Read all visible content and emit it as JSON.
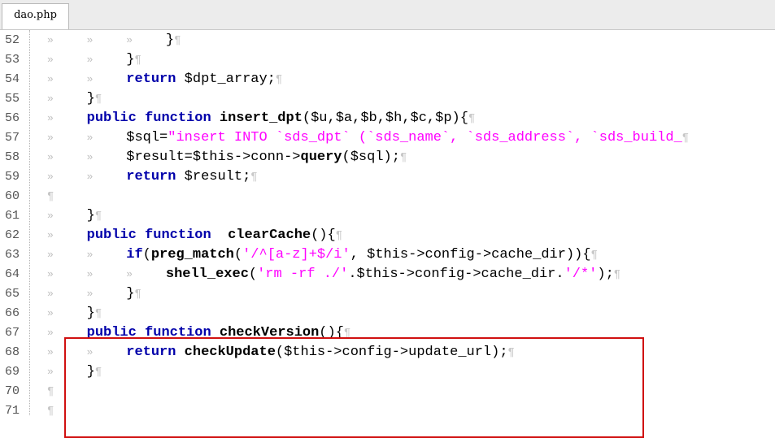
{
  "tab": {
    "filename": "dao.php"
  },
  "colors": {
    "keyword": "#0000aa",
    "string": "#ff00ff",
    "highlight": "#d01010"
  },
  "lines": [
    {
      "n": "52",
      "indent": 3,
      "segs": [
        {
          "t": "}",
          "c": "br"
        }
      ]
    },
    {
      "n": "53",
      "indent": 2,
      "segs": [
        {
          "t": "}",
          "c": "br"
        }
      ]
    },
    {
      "n": "54",
      "indent": 2,
      "segs": [
        {
          "t": "return",
          "c": "kw"
        },
        {
          "t": " $dpt_array;",
          "c": "br"
        }
      ]
    },
    {
      "n": "55",
      "indent": 1,
      "segs": [
        {
          "t": "}",
          "c": "br"
        }
      ]
    },
    {
      "n": "56",
      "indent": 1,
      "segs": [
        {
          "t": "public",
          "c": "kw"
        },
        {
          "t": " ",
          "c": "br"
        },
        {
          "t": "function",
          "c": "kw"
        },
        {
          "t": " ",
          "c": "br"
        },
        {
          "t": "insert_dpt",
          "c": "fn"
        },
        {
          "t": "($u,$a,$b,$h,$c,$p){",
          "c": "br"
        }
      ]
    },
    {
      "n": "57",
      "indent": 2,
      "segs": [
        {
          "t": "$sql=",
          "c": "br"
        },
        {
          "t": "\"insert INTO `sds_dpt` (`sds_name`, `sds_address`, `sds_build_",
          "c": "str"
        }
      ]
    },
    {
      "n": "58",
      "indent": 2,
      "segs": [
        {
          "t": "$result=$this->conn->",
          "c": "br"
        },
        {
          "t": "query",
          "c": "fn"
        },
        {
          "t": "($sql);",
          "c": "br"
        }
      ]
    },
    {
      "n": "59",
      "indent": 2,
      "segs": [
        {
          "t": "return",
          "c": "kw"
        },
        {
          "t": " $result;",
          "c": "br"
        }
      ]
    },
    {
      "n": "60",
      "indent": 0,
      "segs": []
    },
    {
      "n": "61",
      "indent": 1,
      "segs": [
        {
          "t": "}",
          "c": "br"
        }
      ]
    },
    {
      "n": "62",
      "indent": 1,
      "segs": [
        {
          "t": "public",
          "c": "kw"
        },
        {
          "t": " ",
          "c": "br"
        },
        {
          "t": "function",
          "c": "kw"
        },
        {
          "t": "  ",
          "c": "br"
        },
        {
          "t": "clearCache",
          "c": "fn"
        },
        {
          "t": "(){",
          "c": "br"
        }
      ]
    },
    {
      "n": "63",
      "indent": 2,
      "segs": [
        {
          "t": "if",
          "c": "kw"
        },
        {
          "t": "(",
          "c": "br"
        },
        {
          "t": "preg_match",
          "c": "fn"
        },
        {
          "t": "(",
          "c": "br"
        },
        {
          "t": "'/^[a-z]+$/i'",
          "c": "str"
        },
        {
          "t": ", $this->config->cache_dir)){",
          "c": "br"
        }
      ]
    },
    {
      "n": "64",
      "indent": 3,
      "segs": [
        {
          "t": "shell_exec",
          "c": "fn"
        },
        {
          "t": "(",
          "c": "br"
        },
        {
          "t": "'rm -rf ./'",
          "c": "str"
        },
        {
          "t": ".$this->config->cache_dir.",
          "c": "br"
        },
        {
          "t": "'/*'",
          "c": "str"
        },
        {
          "t": ");",
          "c": "br"
        }
      ]
    },
    {
      "n": "65",
      "indent": 2,
      "segs": [
        {
          "t": "}",
          "c": "br"
        }
      ]
    },
    {
      "n": "66",
      "indent": 1,
      "segs": [
        {
          "t": "}",
          "c": "br"
        }
      ]
    },
    {
      "n": "67",
      "indent": 1,
      "segs": [
        {
          "t": "public",
          "c": "kw"
        },
        {
          "t": " ",
          "c": "br"
        },
        {
          "t": "function",
          "c": "kw"
        },
        {
          "t": " ",
          "c": "br"
        },
        {
          "t": "checkVersion",
          "c": "fn"
        },
        {
          "t": "(){",
          "c": "br"
        }
      ]
    },
    {
      "n": "68",
      "indent": 2,
      "segs": [
        {
          "t": "return",
          "c": "kw"
        },
        {
          "t": " ",
          "c": "br"
        },
        {
          "t": "checkUpdate",
          "c": "fn"
        },
        {
          "t": "($this->config->update_url);",
          "c": "br"
        }
      ]
    },
    {
      "n": "69",
      "indent": 1,
      "segs": [
        {
          "t": "}",
          "c": "br"
        }
      ]
    },
    {
      "n": "70",
      "indent": 0,
      "segs": []
    },
    {
      "n": "71",
      "indent": 0,
      "segs": []
    }
  ]
}
